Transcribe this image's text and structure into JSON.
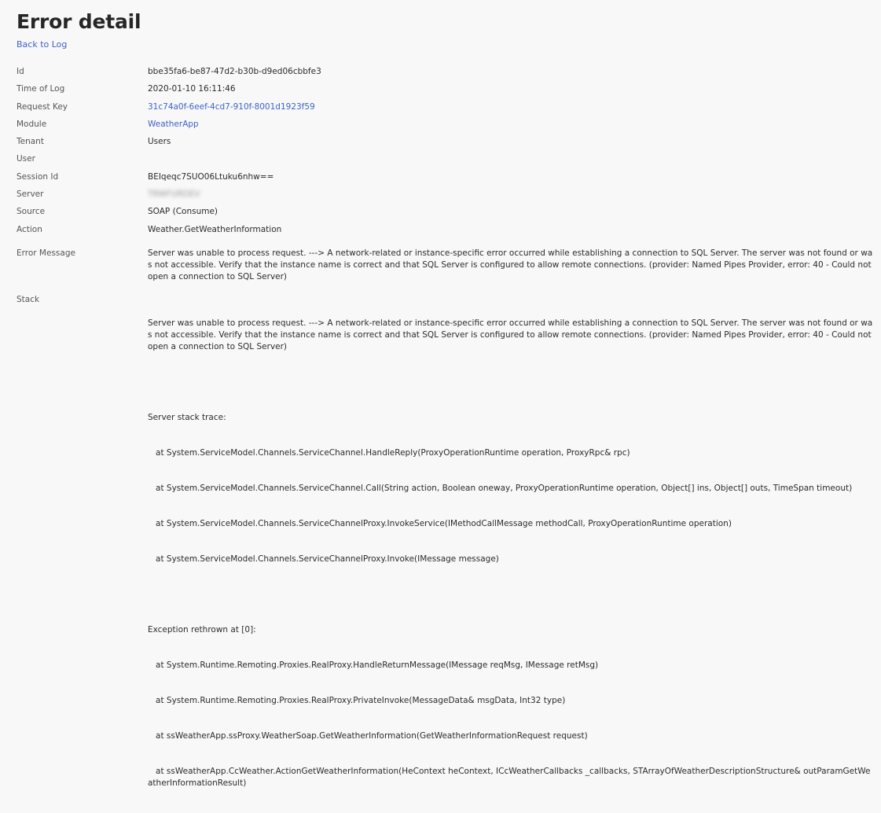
{
  "header": {
    "title": "Error detail",
    "back_link": "Back to Log"
  },
  "details": {
    "id": {
      "label": "Id",
      "value": "bbe35fa6-be87-47d2-b30b-d9ed06cbbfe3"
    },
    "time": {
      "label": "Time of Log",
      "value": "2020-01-10 16:11:46"
    },
    "request_key": {
      "label": "Request Key",
      "value": "31c74a0f-6eef-4cd7-910f-8001d1923f59"
    },
    "module": {
      "label": "Module",
      "value": "WeatherApp"
    },
    "tenant": {
      "label": "Tenant",
      "value": "Users"
    },
    "user": {
      "label": "User",
      "value": ""
    },
    "session_id": {
      "label": "Session Id",
      "value": "BEIqeqc7SUO06Ltuku6nhw=="
    },
    "server": {
      "label": "Server",
      "value": "TRWFURDEV"
    },
    "source": {
      "label": "Source",
      "value": "SOAP (Consume)"
    },
    "action": {
      "label": "Action",
      "value": "Weather.GetWeatherInformation"
    }
  },
  "error_message": {
    "label": "Error Message",
    "value": "Server was unable to process request. ---> A network-related or instance-specific error occurred while establishing a connection to SQL Server. The server was not found or was not accessible. Verify that the instance name is correct and that SQL Server is configured to allow remote connections. (provider: Named Pipes Provider, error: 40 - Could not open a connection to SQL Server)"
  },
  "stack": {
    "label": "Stack",
    "intro": "Server was unable to process request. ---> A network-related or instance-specific error occurred while establishing a connection to SQL Server. The server was not found or was not accessible. Verify that the instance name is correct and that SQL Server is configured to allow remote connections. (provider: Named Pipes Provider, error: 40 - Could not open a connection to SQL Server)",
    "server_trace_header": "Server stack trace:",
    "server_trace": [
      "   at System.ServiceModel.Channels.ServiceChannel.HandleReply(ProxyOperationRuntime operation, ProxyRpc& rpc)",
      "   at System.ServiceModel.Channels.ServiceChannel.Call(String action, Boolean oneway, ProxyOperationRuntime operation, Object[] ins, Object[] outs, TimeSpan timeout)",
      "   at System.ServiceModel.Channels.ServiceChannelProxy.InvokeService(IMethodCallMessage methodCall, ProxyOperationRuntime operation)",
      "   at System.ServiceModel.Channels.ServiceChannelProxy.Invoke(IMessage message)"
    ],
    "rethrown_header": "Exception rethrown at [0]:",
    "rethrown_trace": [
      "   at System.Runtime.Remoting.Proxies.RealProxy.HandleReturnMessage(IMessage reqMsg, IMessage retMsg)",
      "   at System.Runtime.Remoting.Proxies.RealProxy.PrivateInvoke(MessageData& msgData, Int32 type)",
      "   at ssWeatherApp.ssProxy.WeatherSoap.GetWeatherInformation(GetWeatherInformationRequest request)",
      "   at ssWeatherApp.CcWeather.ActionGetWeatherInformation(HeContext heContext, ICcWeatherCallbacks _callbacks, STArrayOfWeatherDescriptionStructure& outParamGetWeatherInformationResult)"
    ]
  },
  "colors": {
    "background": "#f8f8f8",
    "link": "#3f64c8",
    "text": "#333333"
  }
}
